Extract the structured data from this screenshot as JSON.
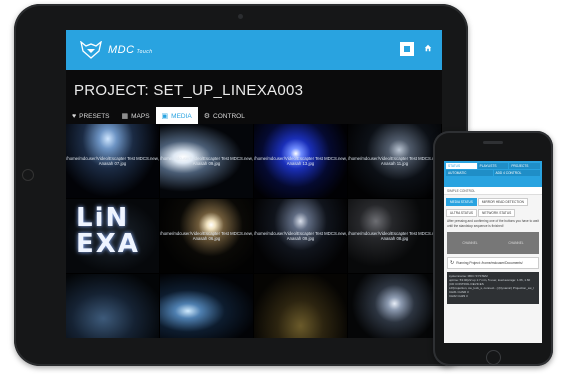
{
  "tablet": {
    "brand": "MDC",
    "brand_sub": "Touch",
    "project_title": "PROJECT: SET_UP_LINEXA003",
    "tabs": [
      {
        "icon": "heart-icon",
        "label": "PRESETS"
      },
      {
        "icon": "map-icon",
        "label": "MAPS"
      },
      {
        "icon": "image-icon",
        "label": "MEDIA"
      },
      {
        "icon": "gear-icon",
        "label": "CONTROL"
      }
    ],
    "active_tab": "MEDIA",
    "media_captions": [
      "/home/mdcuser/Video/Escapter Test MDCS.new, Anasah 07.jpg",
      "/home/mdcuser/Video/Escapter Test MDCS.new, Anasah 09.jpg",
      "/home/mdcuser/Video/Escapter Test MDCS.new, Anasah 13.jpg",
      "/home/mdcuser/Video/Escapter Test MDCS.new, Anasah 11.jpg",
      "/home/mdcuser/Video/Escapter Test MDCS.new, Anasah 06.jpg",
      "/home/mdcuser/Video/Escapter Test MDCS.new, Anasah 09.jpg",
      "/home/mdcuser/Video/Escapter Test MDCS.new, Anasah 08.jpg"
    ],
    "tile_text_linexa": [
      "LiN",
      "EXA"
    ],
    "accent": "#29a3e0"
  },
  "phone": {
    "nav": [
      [
        "STATUS",
        "PLAYLISTS",
        "PROJECTS"
      ],
      [
        "AUTOMATIC",
        "ADD 4 CONTROL"
      ]
    ],
    "simple_control": "SIMPLE CONTROL",
    "tabs1": [
      "MEDIA STATUS",
      "MIRROR HEAD DETECTION"
    ],
    "tabs2": [
      "ULTRA STATUS",
      "NETWORK STATUS"
    ],
    "text1": "After pressing and confirming one of the buttons you have to wait until the standstop sequence is finished!",
    "dark_labels": [
      "CHANNEL",
      "CHANNEL"
    ],
    "running": "Running Project: /home/mdcuser/Documents/",
    "log_lines": [
      "systemname: MDC SYSTEM",
      "uptime: 53:40(22 up 1:7 min, 5 user, load average: 1.66, 1.60",
      "",
      "(CD CONTROL DEVICES",
      "LP/projection, sw_lock_s, connect...[ (Dynamic) Projection_sw_l",
      "CH#1 CHNR 3",
      "CH#2 CH#3 3"
    ]
  }
}
